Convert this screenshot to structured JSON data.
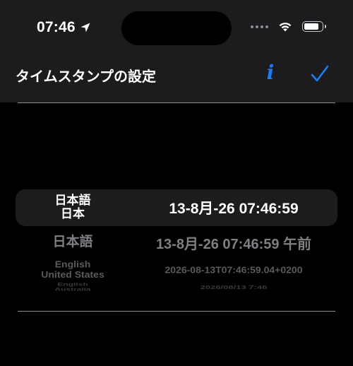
{
  "status_bar": {
    "time": "07:46",
    "location_icon": "location-arrow-icon",
    "cellular_icon": "signal-dots-icon",
    "wifi_icon": "wifi-icon",
    "battery_icon": "battery-icon",
    "battery_level": 0.85
  },
  "nav": {
    "title": "タイムスタンプの設定",
    "info_label": "i",
    "done_icon": "checkmark-icon",
    "accent_color": "#1a7cf2"
  },
  "picker": {
    "rows": [
      {
        "lang_line1": "日本語",
        "lang_line2": "日本",
        "timestamp": "13-8月-26 07:46:59",
        "selected": true
      },
      {
        "lang_line1": "日本語",
        "lang_line2": "",
        "timestamp": "13-8月-26 07:46:59 午前",
        "selected": false
      },
      {
        "lang_line1": "English",
        "lang_line2": "United States",
        "timestamp": "2026-08-13T07:46:59.04+0200",
        "selected": false
      },
      {
        "lang_line1": "English",
        "lang_line2": "Australia",
        "timestamp": "2026/08/13 7:46",
        "selected": false
      }
    ]
  }
}
